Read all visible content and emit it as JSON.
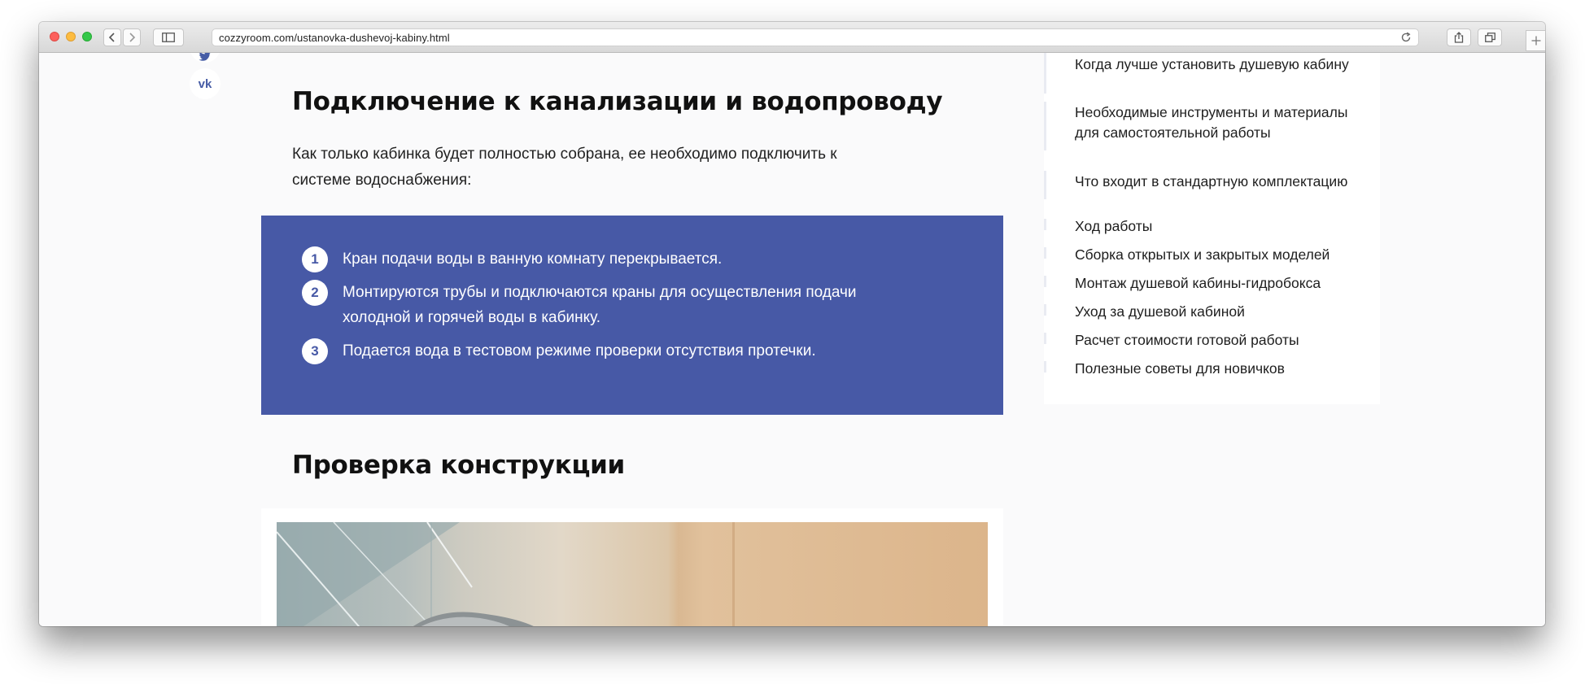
{
  "browser": {
    "url": "cozzyroom.com/ustanovka-dushevoj-kabiny.html",
    "icons": [
      "back-icon",
      "forward-icon",
      "sidebar-icon",
      "reload-icon",
      "share-icon",
      "tabs-icon",
      "new-tab-icon"
    ]
  },
  "share": {
    "icons": [
      "twitter-icon",
      "vk-icon"
    ],
    "vk_label": "vk"
  },
  "main": {
    "section1": {
      "heading": "Подключение к канализации и водопроводу",
      "paragraph": "Как только кабинка будет полностью собрана, ее необходимо подключить к системе водоснабжения:"
    },
    "steps": [
      {
        "number": "1",
        "text": "Кран подачи воды в ванную комнату перекрывается."
      },
      {
        "number": "2",
        "text": "Монтируются трубы и подключаются краны для осуществления подачи холодной и горячей воды в кабинку."
      },
      {
        "number": "3",
        "text": "Подается вода в тестовом режиме проверки отсутствия протечки."
      }
    ],
    "section2": {
      "heading": "Проверка конструкции"
    }
  },
  "toc": {
    "items": [
      {
        "label": "Когда лучше установить душевую кабину"
      },
      {
        "label": "Необходимые инструменты и материалы для самостоятельной работы"
      },
      {
        "label": "Что входит в стандартную комплектацию"
      },
      {
        "label": "Ход работы"
      },
      {
        "label": "Сборка открытых и закрытых моделей"
      },
      {
        "label": "Монтаж душевой кабины-гидробокса"
      },
      {
        "label": "Уход за душевой кабиной"
      },
      {
        "label": "Расчет стоимости готовой работы"
      },
      {
        "label": "Полезные советы для новичков"
      }
    ]
  },
  "colors": {
    "accent": "#4759a6",
    "text": "#1e1e1e",
    "background": "#fafafb"
  }
}
